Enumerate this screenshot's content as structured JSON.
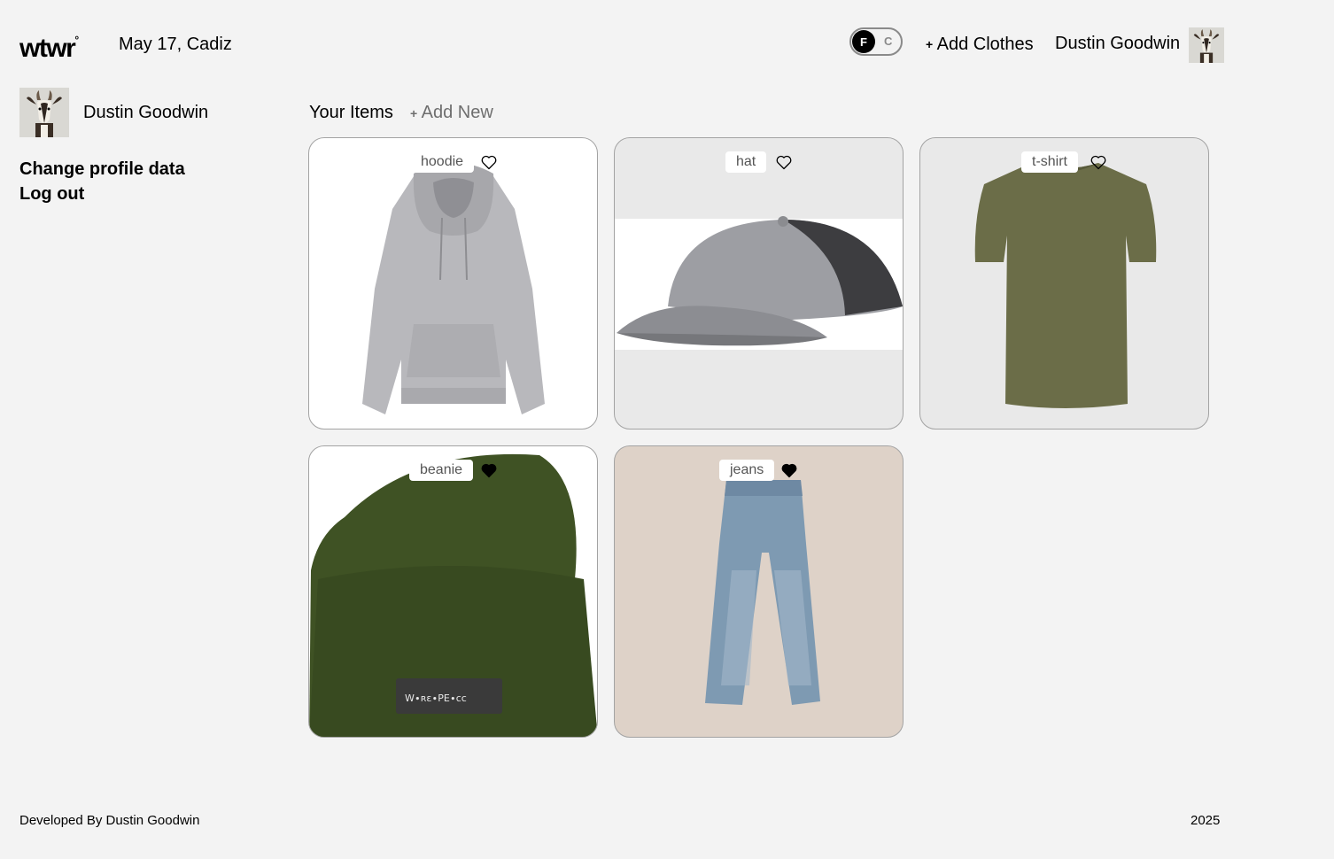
{
  "header": {
    "logo": "wtwr",
    "logo_mark": "°",
    "date_location": "May 17, Cadiz",
    "temp_toggle": {
      "active": "F",
      "inactive": "C"
    },
    "add_clothes_plus": "+",
    "add_clothes_label": "Add Clothes",
    "username": "Dustin Goodwin"
  },
  "sidebar": {
    "username": "Dustin Goodwin",
    "links": [
      "Change profile data",
      "Log out"
    ]
  },
  "main": {
    "title": "Your Items",
    "add_new_plus": "+",
    "add_new_label": "Add New",
    "items": [
      {
        "name": "hoodie",
        "liked": false,
        "icon": "hoodie-image",
        "background": "#ffffff"
      },
      {
        "name": "hat",
        "liked": false,
        "icon": "hat-image",
        "background": "#e9e9e9"
      },
      {
        "name": "t-shirt",
        "liked": false,
        "icon": "tshirt-image",
        "background": "#e9e9e9"
      },
      {
        "name": "beanie",
        "liked": true,
        "icon": "beanie-image",
        "background": "#ffffff"
      },
      {
        "name": "jeans",
        "liked": true,
        "icon": "jeans-image",
        "background": "#ded2c8"
      }
    ]
  },
  "footer": {
    "developer": "Developed By Dustin Goodwin",
    "year": "2025"
  }
}
